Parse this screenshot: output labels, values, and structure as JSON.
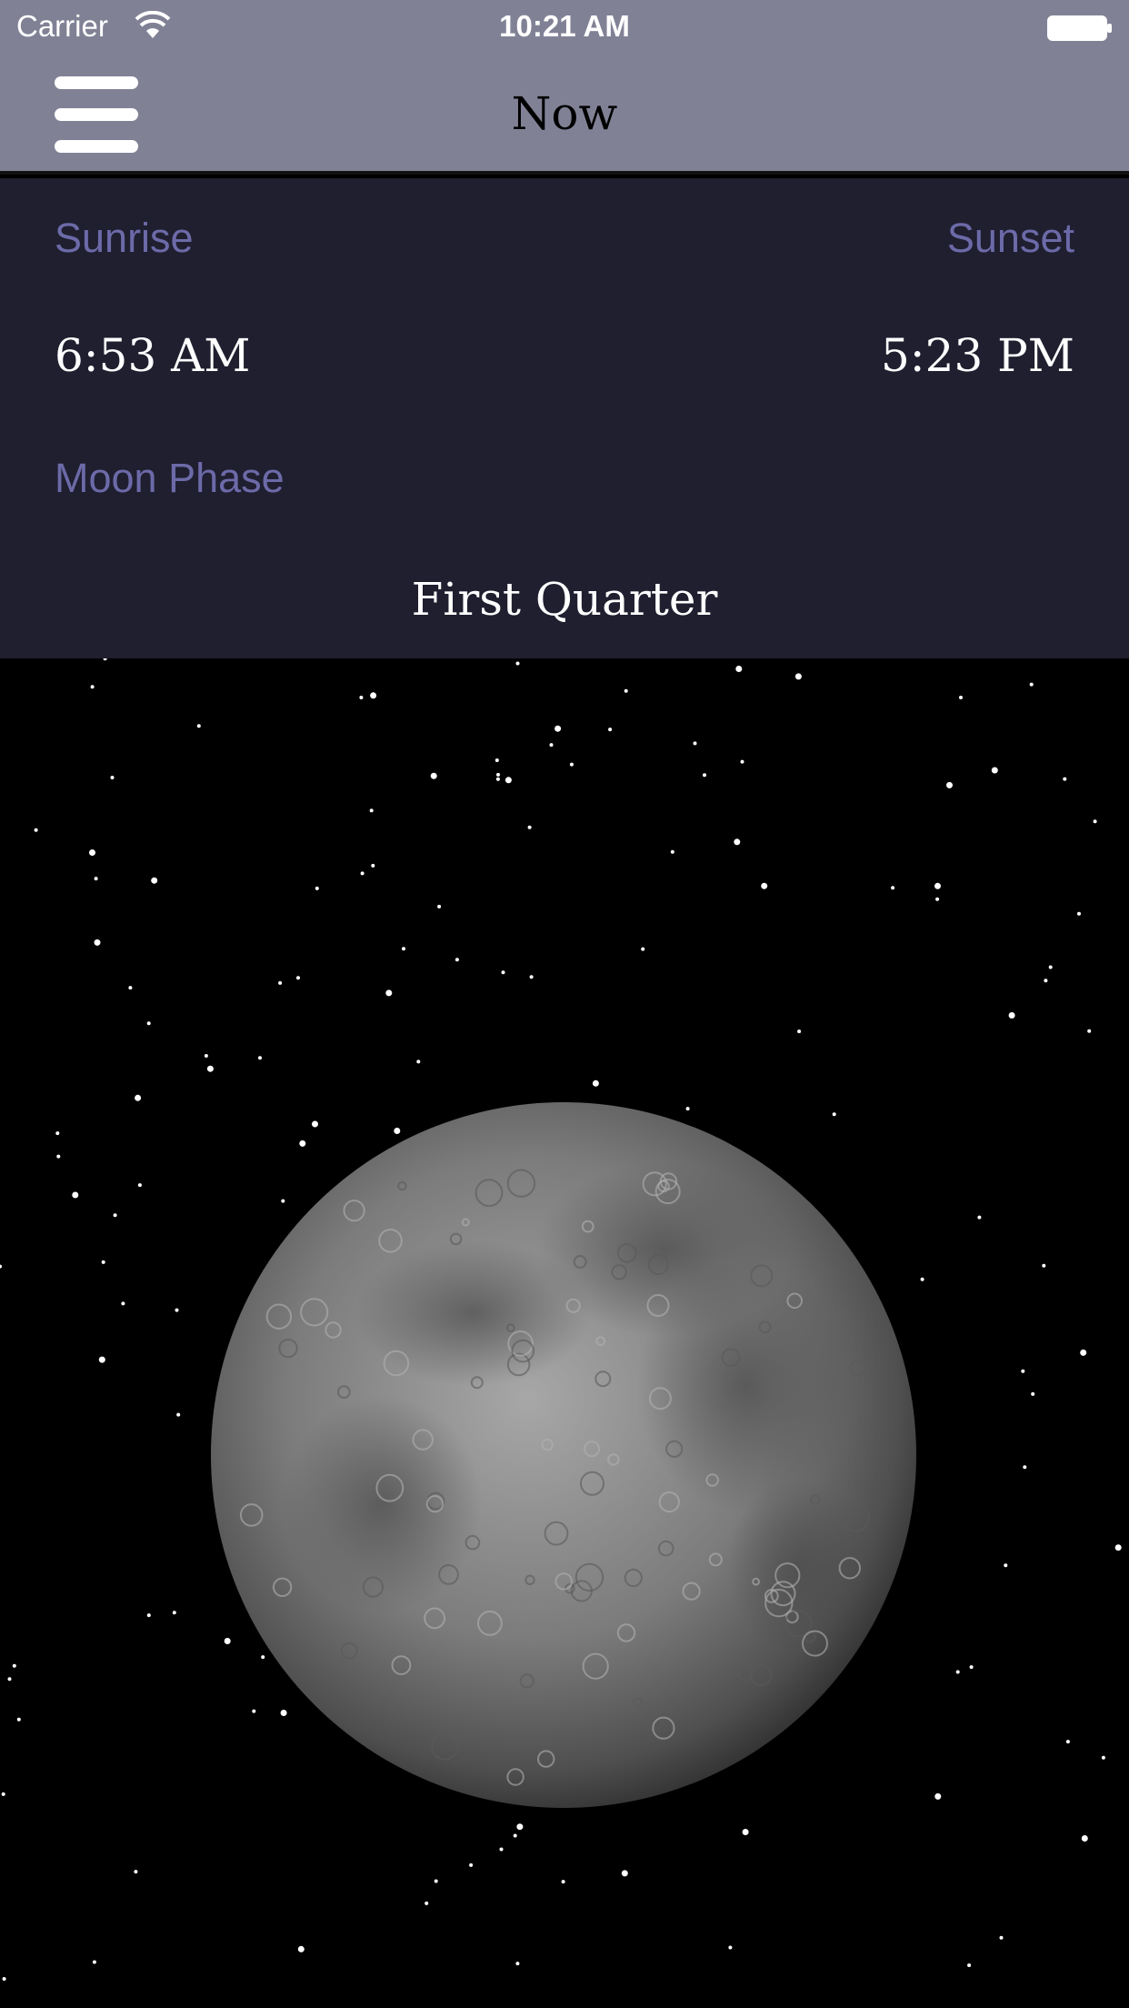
{
  "status_bar": {
    "carrier": "Carrier",
    "time": "10:21 AM"
  },
  "nav": {
    "title": "Now",
    "menu_icon": "hamburger-menu-icon"
  },
  "info": {
    "sunrise_label": "Sunrise",
    "sunrise_time": "6:53 AM",
    "sunset_label": "Sunset",
    "sunset_time": "5:23 PM",
    "moon_phase_label": "Moon Phase",
    "moon_phase_value": "First Quarter"
  },
  "colors": {
    "bar_background": "#818196",
    "panel_background": "#1f1f30",
    "label_color": "#6c6aa8",
    "sky": "#000000"
  }
}
